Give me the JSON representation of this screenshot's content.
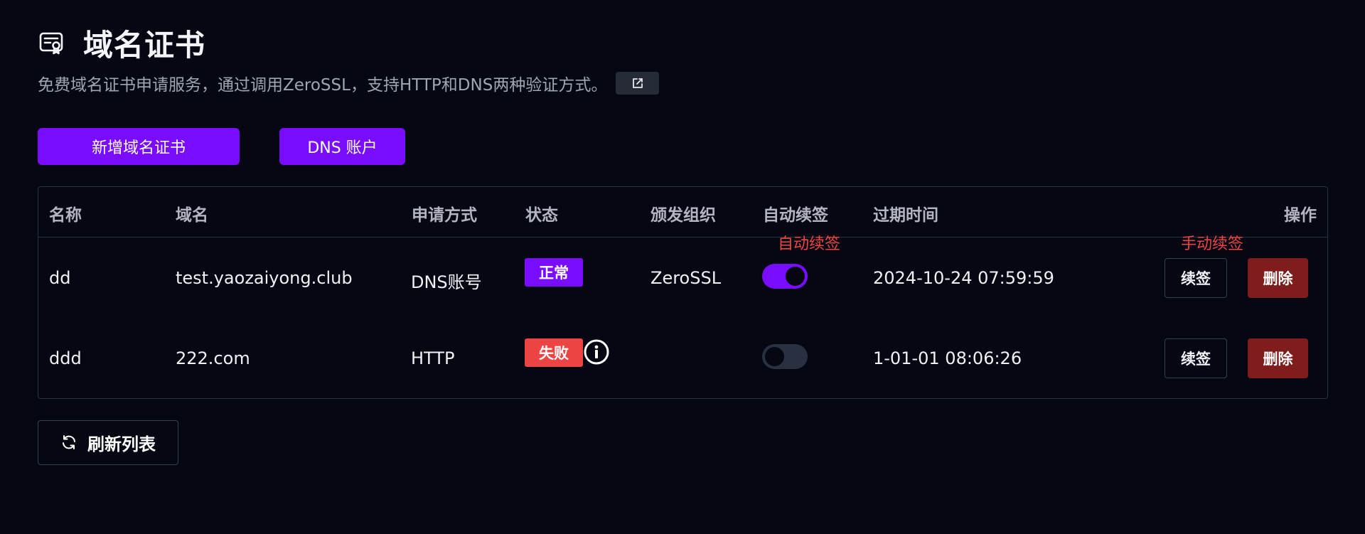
{
  "header": {
    "title": "域名证书",
    "subtitle": "免费域名证书申请服务，通过调用ZeroSSL，支持HTTP和DNS两种验证方式。",
    "icon": "certificate-icon",
    "link_icon": "external-link-icon"
  },
  "toolbar": {
    "add_label": "新增域名证书",
    "dns_label": "DNS 账户"
  },
  "table": {
    "columns": {
      "name": "名称",
      "domain": "域名",
      "method": "申请方式",
      "status": "状态",
      "issuer": "颁发组织",
      "auto_renew": "自动续签",
      "expire": "过期时间",
      "actions": "操作"
    },
    "rows": [
      {
        "name": "dd",
        "domain": "test.yaozaiyong.club",
        "method": "DNS账号",
        "status": "正常",
        "issuer": "ZeroSSL",
        "auto_renew": true,
        "expire": "2024-10-24 07:59:59",
        "renew_label": "续签",
        "delete_label": "删除"
      },
      {
        "name": "ddd",
        "domain": "222.com",
        "method": "HTTP",
        "status": "失败",
        "issuer": "",
        "auto_renew": false,
        "expire": "1-01-01 08:06:26",
        "renew_label": "续签",
        "delete_label": "删除"
      }
    ]
  },
  "annotations": {
    "auto_renew": "自动续签",
    "manual_renew": "手动续签"
  },
  "footer": {
    "refresh_label": "刷新列表",
    "refresh_icon": "refresh-icon"
  },
  "colors": {
    "background": "#050713",
    "accent": "#7a0cff",
    "danger": "#ec4343",
    "delete": "#7f1d1d",
    "annotation": "#ef4444"
  }
}
